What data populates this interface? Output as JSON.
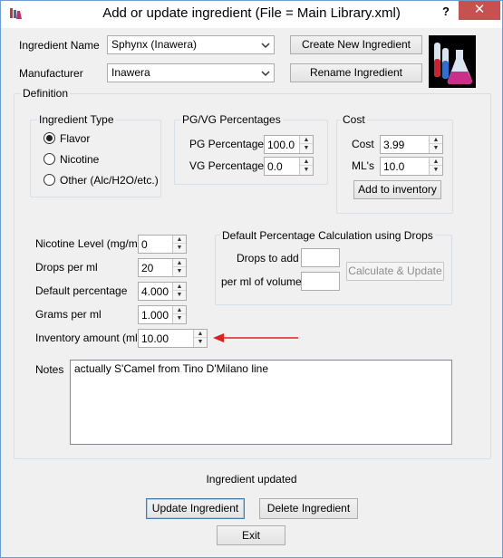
{
  "window": {
    "title": "Add or update ingredient (File = Main Library.xml)",
    "help_label": "?",
    "close_label": "✕"
  },
  "ingredient": {
    "name_label": "Ingredient Name",
    "name_value": "Sphynx (Inawera)",
    "manufacturer_label": "Manufacturer",
    "manufacturer_value": "Inawera",
    "create_button": "Create New Ingredient",
    "rename_button": "Rename Ingredient"
  },
  "definition": {
    "title": "Definition",
    "ingredient_type": {
      "title": "Ingredient Type",
      "options": [
        "Flavor",
        "Nicotine",
        "Other (Alc/H2O/etc.)"
      ],
      "selected": "Flavor"
    },
    "pgvg": {
      "title": "PG/VG Percentages",
      "pg_label": "PG Percentage",
      "pg_value": "100.0",
      "vg_label": "VG Percentage",
      "vg_value": "0.0"
    },
    "cost": {
      "title": "Cost",
      "cost_label": "Cost",
      "cost_value": "3.99",
      "mls_label": "ML's",
      "mls_value": "10.0",
      "add_button": "Add to inventory"
    },
    "fields": {
      "nicotine_label": "Nicotine Level (mg/ml)",
      "nicotine_value": "0",
      "drops_label": "Drops per ml",
      "drops_value": "20",
      "default_pct_label": "Default percentage",
      "default_pct_value": "4.000",
      "grams_label": "Grams per ml",
      "grams_value": "1.000",
      "inventory_label": "Inventory amount (ml)",
      "inventory_value": "10.00"
    },
    "drops_calc": {
      "title": "Default Percentage Calculation using Drops",
      "drops_to_add_label": "Drops to add",
      "per_ml_label": "per ml of volume",
      "calc_button": "Calculate & Update"
    },
    "notes": {
      "label": "Notes",
      "value": "actually S'Camel from Tino D'Milano line"
    }
  },
  "status": {
    "message": "Ingredient updated"
  },
  "buttons": {
    "update": "Update Ingredient",
    "delete": "Delete Ingredient",
    "exit": "Exit"
  },
  "colors": {
    "close_button": "#c75050",
    "annotation_arrow": "#e02020",
    "window_border": "#6f9bd0"
  }
}
